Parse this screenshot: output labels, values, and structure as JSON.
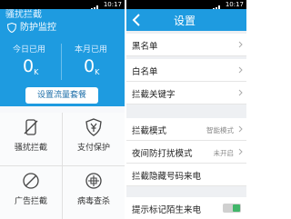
{
  "left_screen": {
    "status_time": "10:17",
    "partial_title": "骚扰拦截",
    "protect_label": "防护监控",
    "today_label": "今日已用",
    "today_value": "0",
    "today_unit": "K",
    "month_label": "本月已用",
    "month_value": "0",
    "month_unit": "K",
    "set_plan_button": "设置流量套餐",
    "tiles": [
      {
        "label": "骚扰拦截",
        "icon": "phone-block-icon"
      },
      {
        "label": "支付保护",
        "icon": "yen-shield-icon"
      },
      {
        "label": "广告拦截",
        "icon": "ad-block-icon"
      },
      {
        "label": "病毒查杀",
        "icon": "virus-scan-icon"
      }
    ]
  },
  "right_screen": {
    "status_time": "10:17",
    "title": "设置",
    "rows": [
      {
        "label": "黑名单"
      },
      {
        "label": "白名单"
      },
      {
        "label": "拦截关键字"
      },
      {
        "label": "拦截模式",
        "value": "智能模式"
      },
      {
        "label": "夜间防打扰模式",
        "value": "未开启"
      },
      {
        "label": "拦截隐藏号码来电",
        "toggle": true
      },
      {
        "label": "提示标记陌生来电"
      }
    ]
  },
  "colors": {
    "accent_blue": "#1e9be0",
    "toggle_green": "#41b66a"
  }
}
